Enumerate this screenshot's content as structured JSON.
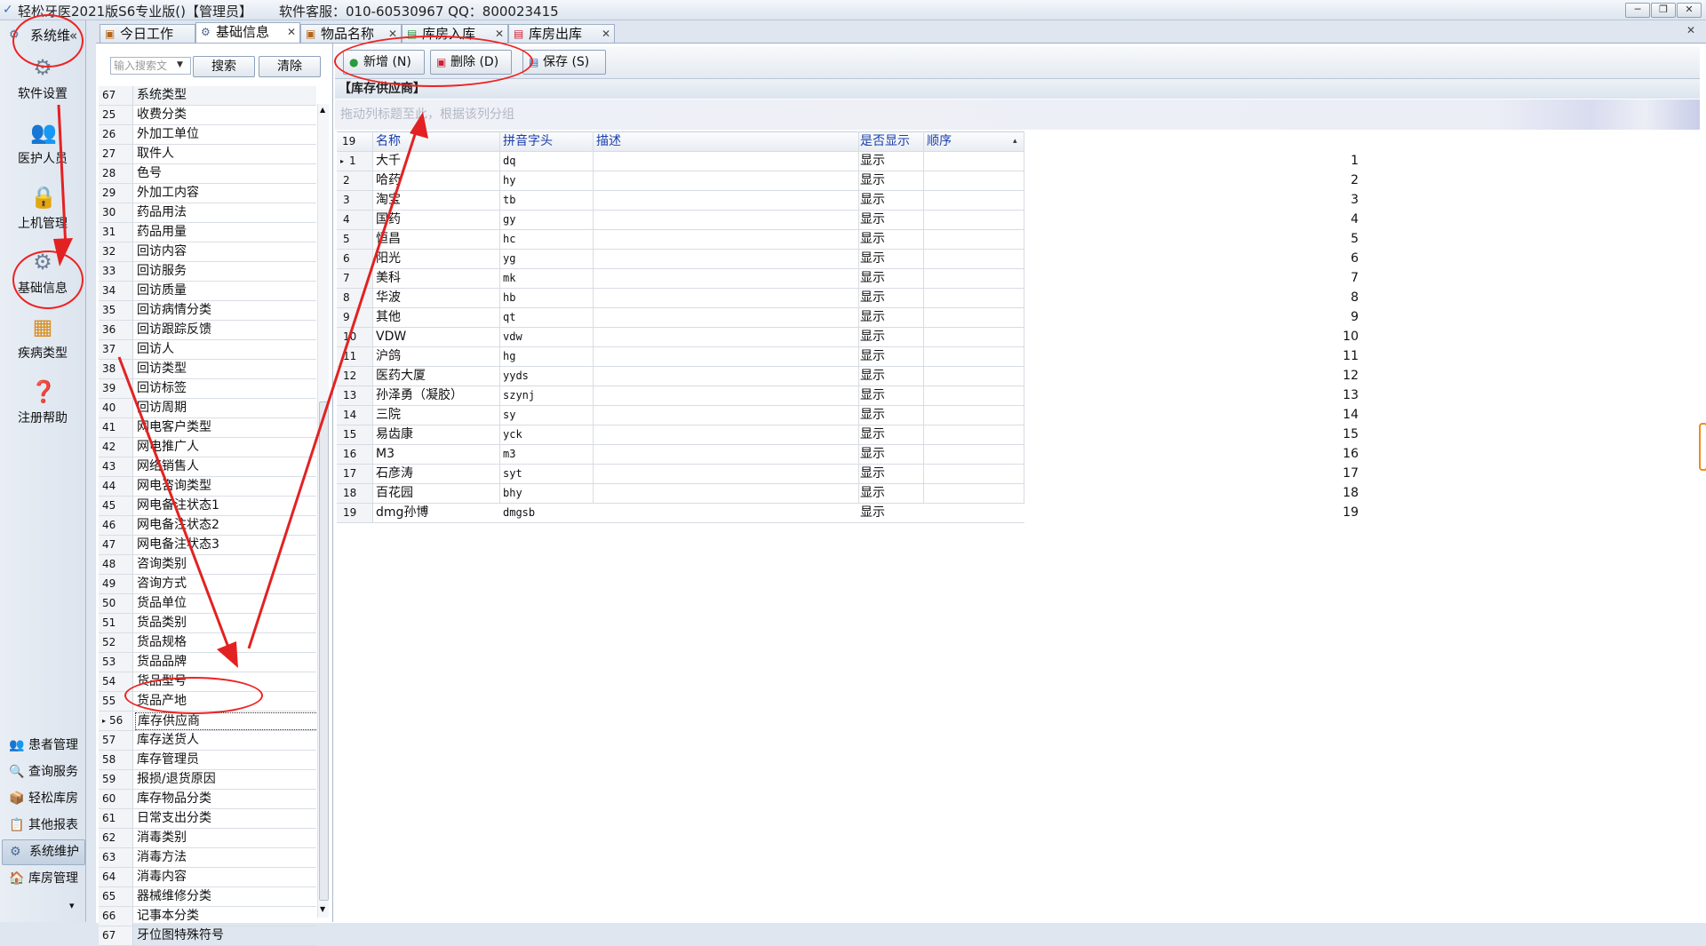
{
  "window": {
    "title": "轻松牙医2021版S6专业版()【管理员】",
    "info": "软件客服：010-60530967 QQ：800023415",
    "btn_min": "─",
    "btn_restore": "❐",
    "btn_close": "✕"
  },
  "leftnav": {
    "system_tab": "系统维",
    "collapse": "«",
    "items": [
      {
        "label": "软件设置",
        "icon": "gear-icon"
      },
      {
        "label": "医护人员",
        "icon": "staff-icon"
      },
      {
        "label": "上机管理",
        "icon": "lock-icon"
      },
      {
        "label": "基础信息",
        "icon": "settings-icon"
      },
      {
        "label": "疾病类型",
        "icon": "tree-icon"
      },
      {
        "label": "注册帮助",
        "icon": "help-icon"
      }
    ],
    "bottom": [
      {
        "label": "患者管理"
      },
      {
        "label": "查询服务"
      },
      {
        "label": "轻松库房"
      },
      {
        "label": "其他报表"
      },
      {
        "label": "系统维护"
      },
      {
        "label": "库房管理"
      }
    ],
    "more": "▾"
  },
  "tabs": [
    {
      "label": "今日工作"
    },
    {
      "label": "基础信息"
    },
    {
      "label": "物品名称"
    },
    {
      "label": "库房入库"
    },
    {
      "label": "库房出库"
    }
  ],
  "list": {
    "search_placeholder": "输入搜索文",
    "search_label": "搜索",
    "clear_label": "清除",
    "header_num": "67",
    "header_name": "系统类型",
    "rows": [
      {
        "num": "25",
        "name": "收费分类"
      },
      {
        "num": "26",
        "name": "外加工单位"
      },
      {
        "num": "27",
        "name": "取件人"
      },
      {
        "num": "28",
        "name": "色号"
      },
      {
        "num": "29",
        "name": "外加工内容"
      },
      {
        "num": "30",
        "name": "药品用法"
      },
      {
        "num": "31",
        "name": "药品用量"
      },
      {
        "num": "32",
        "name": "回访内容"
      },
      {
        "num": "33",
        "name": "回访服务"
      },
      {
        "num": "34",
        "name": "回访质量"
      },
      {
        "num": "35",
        "name": "回访病情分类"
      },
      {
        "num": "36",
        "name": "回访跟踪反馈"
      },
      {
        "num": "37",
        "name": "回访人"
      },
      {
        "num": "38",
        "name": "回访类型"
      },
      {
        "num": "39",
        "name": "回访标签"
      },
      {
        "num": "40",
        "name": "回访周期"
      },
      {
        "num": "41",
        "name": "网电客户类型"
      },
      {
        "num": "42",
        "name": "网电推广人"
      },
      {
        "num": "43",
        "name": "网络销售人"
      },
      {
        "num": "44",
        "name": "网电咨询类型"
      },
      {
        "num": "45",
        "name": "网电备注状态1"
      },
      {
        "num": "46",
        "name": "网电备注状态2"
      },
      {
        "num": "47",
        "name": "网电备注状态3"
      },
      {
        "num": "48",
        "name": "咨询类别"
      },
      {
        "num": "49",
        "name": "咨询方式"
      },
      {
        "num": "50",
        "name": "货品单位"
      },
      {
        "num": "51",
        "name": "货品类别"
      },
      {
        "num": "52",
        "name": "货品规格"
      },
      {
        "num": "53",
        "name": "货品品牌"
      },
      {
        "num": "54",
        "name": "货品型号"
      },
      {
        "num": "55",
        "name": "货品产地"
      },
      {
        "num": "56",
        "name": "库存供应商"
      },
      {
        "num": "57",
        "name": "库存送货人"
      },
      {
        "num": "58",
        "name": "库存管理员"
      },
      {
        "num": "59",
        "name": "报损/退货原因"
      },
      {
        "num": "60",
        "name": "库存物品分类"
      },
      {
        "num": "61",
        "name": "日常支出分类"
      },
      {
        "num": "62",
        "name": "消毒类别"
      },
      {
        "num": "63",
        "name": "消毒方法"
      },
      {
        "num": "64",
        "name": "消毒内容"
      },
      {
        "num": "65",
        "name": "器械维修分类"
      },
      {
        "num": "66",
        "name": "记事本分类"
      },
      {
        "num": "67",
        "name": "牙位图特殊符号"
      }
    ],
    "selected_marker": "▸"
  },
  "toolbar": {
    "add_label": "新增 (N)",
    "delete_label": "删除 (D)",
    "save_label": "保存 (S)"
  },
  "section_title": "【库存供应商】",
  "group_hint": "拖动列标题至此，根据该列分组",
  "grid": {
    "count": "19",
    "columns": {
      "name": "名称",
      "pinyin": "拼音字头",
      "desc": "描述",
      "show": "是否显示",
      "order": "顺序"
    },
    "sort_icon": "▴",
    "rows": [
      {
        "num": "1",
        "name": "大千",
        "pinyin": "dq",
        "show": "显示",
        "order": "1"
      },
      {
        "num": "2",
        "name": "哈药",
        "pinyin": "hy",
        "show": "显示",
        "order": "2"
      },
      {
        "num": "3",
        "name": "淘宝",
        "pinyin": "tb",
        "show": "显示",
        "order": "3"
      },
      {
        "num": "4",
        "name": "国药",
        "pinyin": "gy",
        "show": "显示",
        "order": "4"
      },
      {
        "num": "5",
        "name": "恒昌",
        "pinyin": "hc",
        "show": "显示",
        "order": "5"
      },
      {
        "num": "6",
        "name": "阳光",
        "pinyin": "yg",
        "show": "显示",
        "order": "6"
      },
      {
        "num": "7",
        "name": "美科",
        "pinyin": "mk",
        "show": "显示",
        "order": "7"
      },
      {
        "num": "8",
        "name": "华波",
        "pinyin": "hb",
        "show": "显示",
        "order": "8"
      },
      {
        "num": "9",
        "name": "其他",
        "pinyin": "qt",
        "show": "显示",
        "order": "9"
      },
      {
        "num": "10",
        "name": "VDW",
        "pinyin": "vdw",
        "show": "显示",
        "order": "10"
      },
      {
        "num": "11",
        "name": "沪鸽",
        "pinyin": "hg",
        "show": "显示",
        "order": "11"
      },
      {
        "num": "12",
        "name": "医药大厦",
        "pinyin": "yyds",
        "show": "显示",
        "order": "12"
      },
      {
        "num": "13",
        "name": "孙泽勇（凝胶）",
        "pinyin": "szynj",
        "show": "显示",
        "order": "13"
      },
      {
        "num": "14",
        "name": "三院",
        "pinyin": "sy",
        "show": "显示",
        "order": "14"
      },
      {
        "num": "15",
        "name": "易齿康",
        "pinyin": "yck",
        "show": "显示",
        "order": "15"
      },
      {
        "num": "16",
        "name": "M3",
        "pinyin": "m3",
        "show": "显示",
        "order": "16"
      },
      {
        "num": "17",
        "name": "石彦涛",
        "pinyin": "syt",
        "show": "显示",
        "order": "17"
      },
      {
        "num": "18",
        "name": "百花园",
        "pinyin": "bhy",
        "show": "显示",
        "order": "18"
      },
      {
        "num": "19",
        "name": "dmg孙博",
        "pinyin": "dmgsb",
        "show": "显示",
        "order": "19"
      }
    ],
    "current_marker": "▸"
  },
  "colors": {
    "annotation": "#e22222",
    "accent": "#1a3fae"
  }
}
